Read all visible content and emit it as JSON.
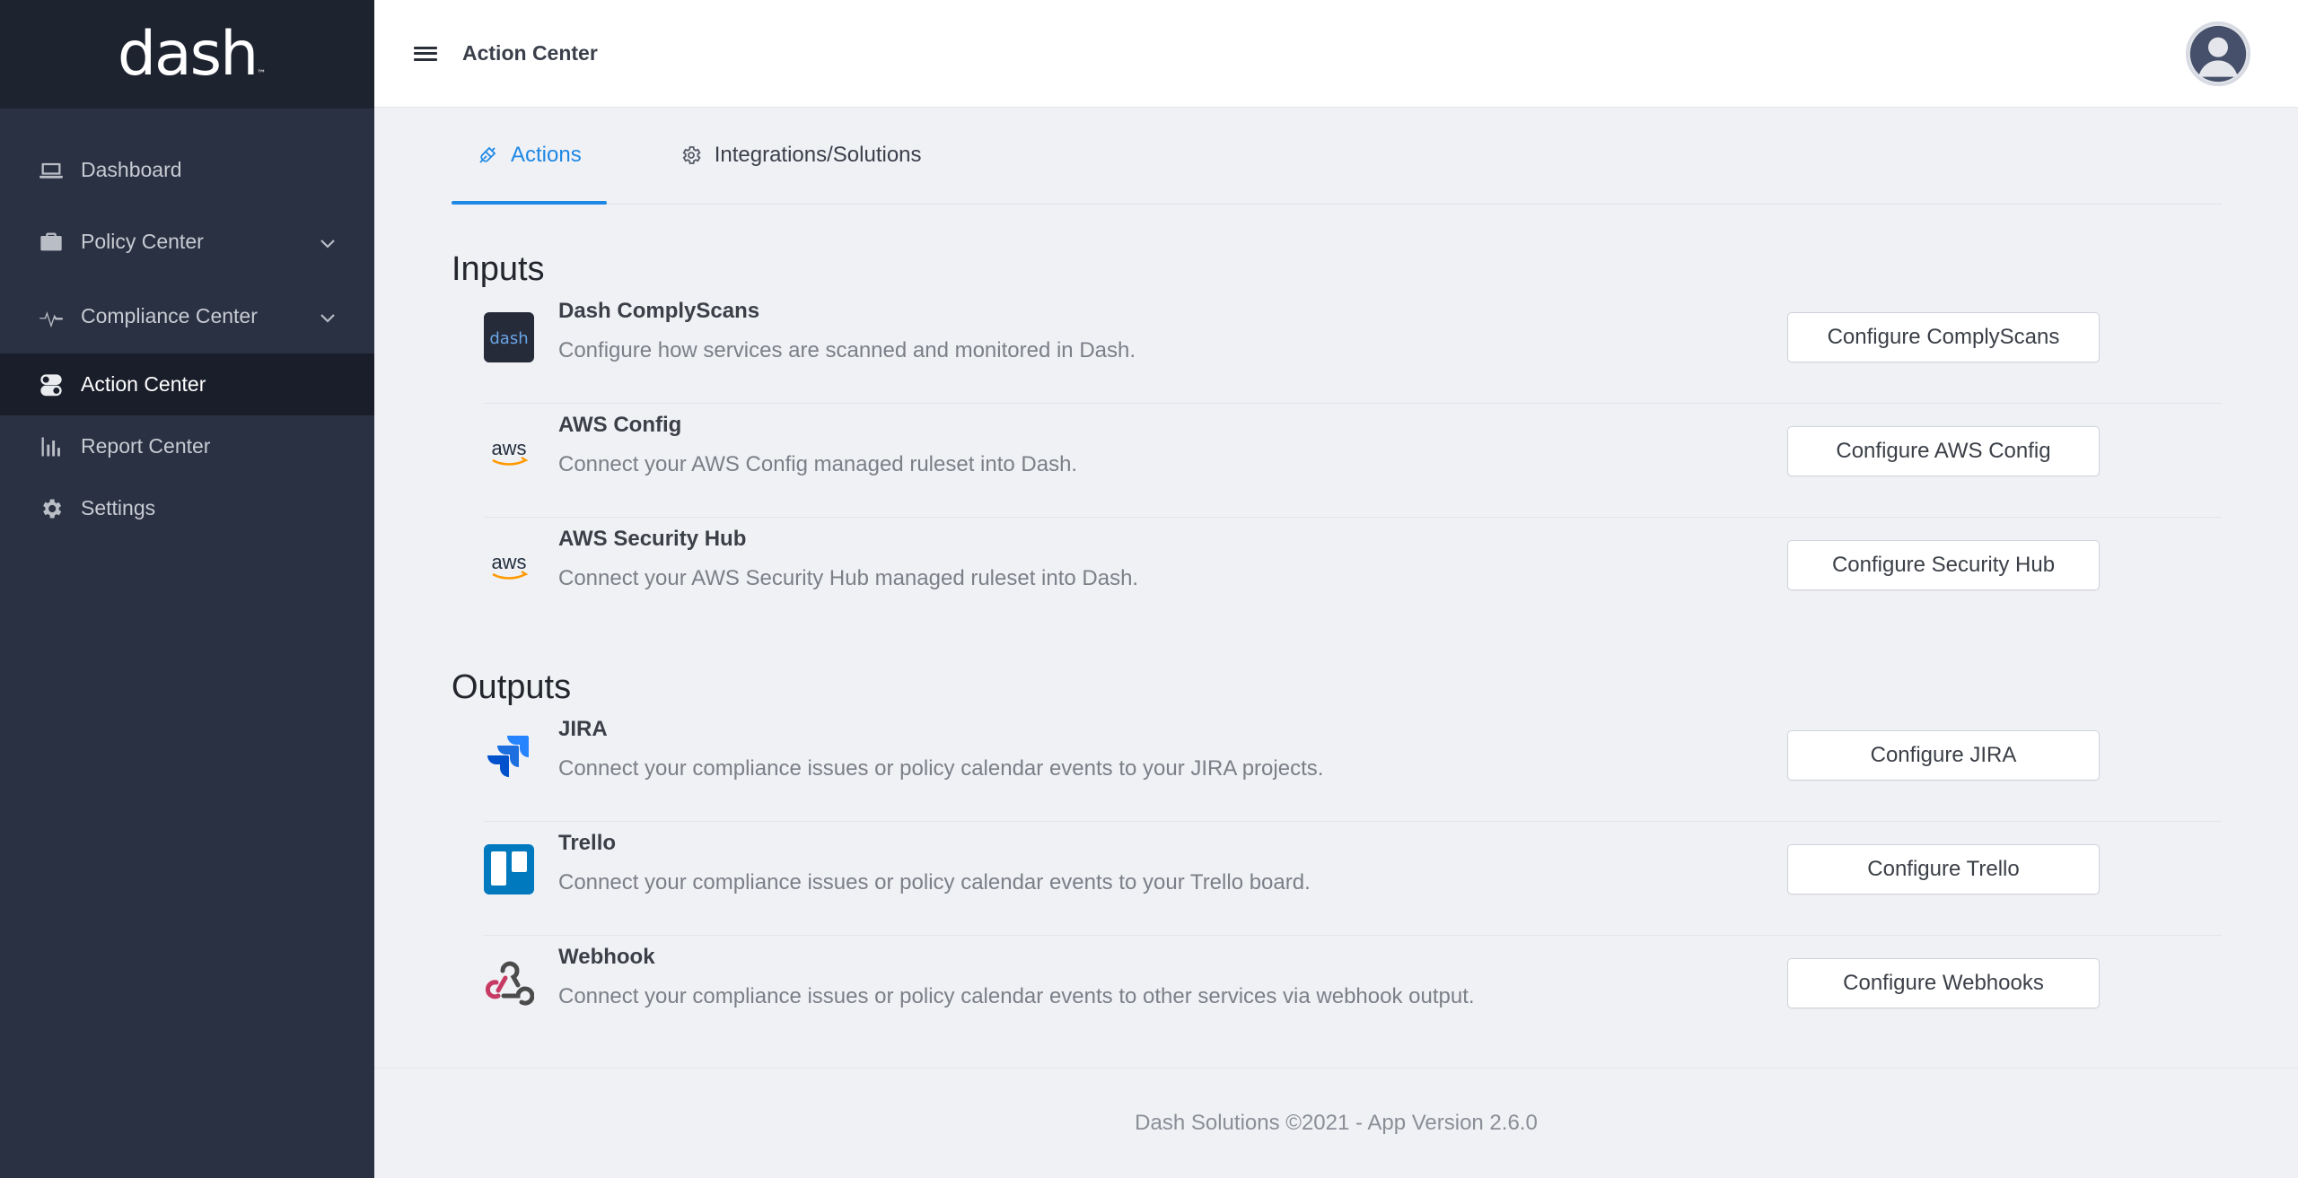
{
  "brand": {
    "logo_text": "dash",
    "tm": "™"
  },
  "sidebar": {
    "items": [
      {
        "label": "Dashboard",
        "icon": "laptop-icon"
      },
      {
        "label": "Policy Center",
        "icon": "briefcase-icon",
        "expandable": true
      },
      {
        "label": "Compliance Center",
        "icon": "heartbeat-icon",
        "expandable": true
      },
      {
        "label": "Action Center",
        "icon": "toggle-icon",
        "active": true
      },
      {
        "label": "Report Center",
        "icon": "bar-chart-icon"
      },
      {
        "label": "Settings",
        "icon": "gear-icon"
      }
    ]
  },
  "topbar": {
    "title": "Action Center"
  },
  "tabs": [
    {
      "label": "Actions",
      "icon": "plug-icon",
      "active": true
    },
    {
      "label": "Integrations/Solutions",
      "icon": "gear-icon"
    }
  ],
  "inputs": {
    "title": "Inputs",
    "items": [
      {
        "name": "Dash ComplyScans",
        "desc": "Configure how services are scanned and monitored in Dash.",
        "button": "Configure ComplyScans",
        "logo": "dash-logo",
        "logo_text": "dash"
      },
      {
        "name": "AWS Config",
        "desc": "Connect your AWS Config managed ruleset into Dash.",
        "button": "Configure AWS Config",
        "logo": "aws-logo",
        "logo_text": "aws"
      },
      {
        "name": "AWS Security Hub",
        "desc": "Connect your AWS Security Hub managed ruleset into Dash.",
        "button": "Configure Security Hub",
        "logo": "aws-logo",
        "logo_text": "aws"
      }
    ]
  },
  "outputs": {
    "title": "Outputs",
    "items": [
      {
        "name": "JIRA",
        "desc": "Connect your compliance issues or policy calendar events to your JIRA projects.",
        "button": "Configure JIRA",
        "logo": "jira-logo"
      },
      {
        "name": "Trello",
        "desc": "Connect your compliance issues or policy calendar events to your Trello board.",
        "button": "Configure Trello",
        "logo": "trello-logo"
      },
      {
        "name": "Webhook",
        "desc": "Connect your compliance issues or policy calendar events to other services via webhook output.",
        "button": "Configure Webhooks",
        "logo": "webhook-logo"
      }
    ]
  },
  "footer": {
    "text": "Dash Solutions ©2021 - App Version 2.6.0"
  },
  "colors": {
    "sidebar": "#2a3142",
    "brand_bg": "#1e2330",
    "accent": "#1e88e5",
    "page_bg": "#f0f1f5"
  }
}
